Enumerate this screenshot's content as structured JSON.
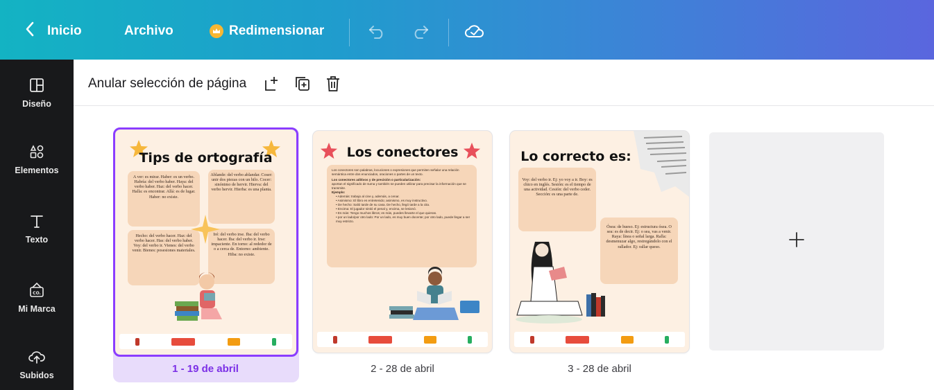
{
  "topbar": {
    "home_label": "Inicio",
    "file_label": "Archivo",
    "resize_label": "Redimensionar",
    "icons": [
      "chevron-left-icon",
      "crown-icon",
      "undo-icon",
      "redo-icon",
      "cloud-check-icon"
    ]
  },
  "sidebar": {
    "items": [
      {
        "label": "Diseño",
        "icon": "layout-icon"
      },
      {
        "label": "Elementos",
        "icon": "shapes-icon"
      },
      {
        "label": "Texto",
        "icon": "text-icon"
      },
      {
        "label": "Mi Marca",
        "icon": "brand-icon"
      },
      {
        "label": "Subidos",
        "icon": "cloud-upload-icon"
      }
    ]
  },
  "toolbar": {
    "deselect_label": "Anular selección de página",
    "icons": [
      "add-page-icon",
      "duplicate-page-icon",
      "delete-page-icon"
    ]
  },
  "pages": [
    {
      "label": "1 - 19 de abril",
      "selected": true,
      "title": "Tips de ortografía",
      "blocks": [
        "A ver: es mirar. Haber: es un verbo. Habría: del verbo haber. Haya: del verbo haber. Haz: del verbo hacer. Halla: es encontrar. Allá: es de lugar. Haber: no existe.",
        "Ablande: del verbo ablandar. Coser: unir dos piezas con un hilo. Cocer: sinónimo de hervir. Hierva: del verbo hervir. Hierba: es una planta.",
        "Hecho: del verbo hacer. Haz: del verbo hacer. Has: del verbo haber. Voy: del verbo ir. Vienes: del verbo venir. Bienes: posesiones materiales.",
        "Iré: del verbo irse. Iba: del verbo hacer. Iba: del verbo ir. Irse: impaciente. En torno: al rededor de o a cerca de. Entorno: ambiente. Hiba: no existe."
      ]
    },
    {
      "label": "2 - 28 de abril",
      "selected": false,
      "title": "Los conectores",
      "intro": "Los conectores son palabras, locuciones o expresiones que permiten señalar una relación semántica entre dos enunciados, oraciones o partes de un texto.",
      "subtitle": "Los conectores aditivos y de precisión o particularización:",
      "desc": "aportan el significado de suma y también se pueden utilizar para precisar la información que se transmite.",
      "example_label": "Ejemplo:",
      "bullets": [
        "Además: trabajo al cine y, además, a cenar.",
        "Asimismo: El libro es entretenido; asimismo, es muy instructivo.",
        "De hecho: Salió tarde de su casa. De hecho, llegó tarde a la cita.",
        "Encima: El jugador sintió el penal y, encima, se lesionó.",
        "Es más: Tengo muchos libros; es más, puedes llevarte el que quieras.",
        "por un lado/por otro lado: Por un lado, es muy buen docente; por otro lado, puede llegar a ser muy estricto."
      ]
    },
    {
      "label": "3 - 28 de abril",
      "selected": false,
      "title": "Lo correcto es:",
      "block1": "Voy: del verbo ir. Ej: yo voy a ir. Boy: es chico en inglés. Sesión: es el tiempo de una actividad. Cesión: del verbo ceder. Sección: es una parte de.",
      "block2": "Ósea: de hueso. Ej: estructura ósea. O sea: es de decir. Ej: o sea, vas a venir. Raya: línea o señal larga. Ralla: desmenuzar algo, restregándolo con el rallador. Ej: rallar queso."
    }
  ],
  "add_page_icon": "plus-icon",
  "footer_logos": {
    "university": "Universidad Francisco de Paula Santander",
    "faculty": "Facultad de Educación, Artes y Humanidades",
    "brand": "COLE"
  },
  "colors": {
    "accent": "#8b3dff",
    "sidebar_bg": "#18191b",
    "card_bg": "#fdf0e3",
    "box_bg": "#f6d6b9",
    "star": "#f6b73c",
    "star_red": "#e8505b"
  }
}
